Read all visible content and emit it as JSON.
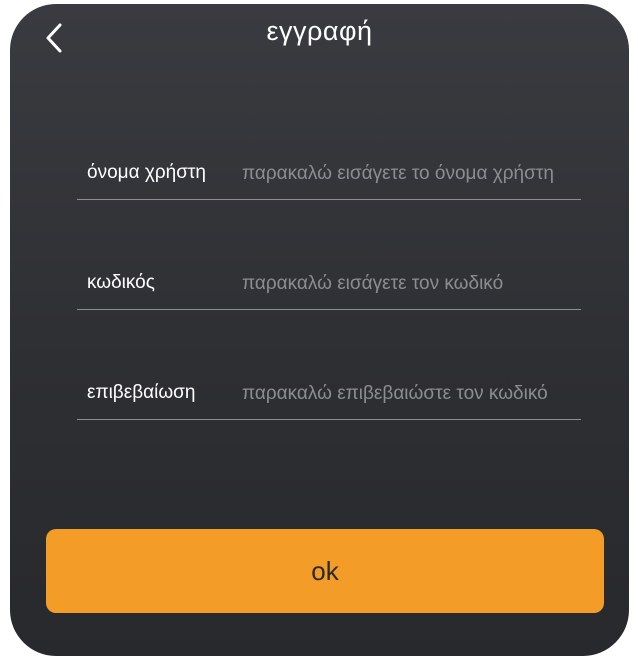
{
  "header": {
    "title": "εγγραφή",
    "back_icon": "chevron-left-icon"
  },
  "form": {
    "username": {
      "label": "όνομα χρήστη",
      "value": "",
      "placeholder": "παρακαλώ εισάγετε το όνομα χρήστη"
    },
    "password": {
      "label": "κωδικός",
      "value": "",
      "placeholder": "παρακαλώ εισάγετε τον κωδικό"
    },
    "confirm": {
      "label": "επιβεβαίωση",
      "value": "",
      "placeholder": "παρακαλώ επιβεβαιώστε τον κωδικό"
    }
  },
  "actions": {
    "ok_label": "ok"
  },
  "colors": {
    "accent": "#f39c28",
    "background": "#333438",
    "text": "#ffffff",
    "placeholder": "#8c8d91"
  }
}
